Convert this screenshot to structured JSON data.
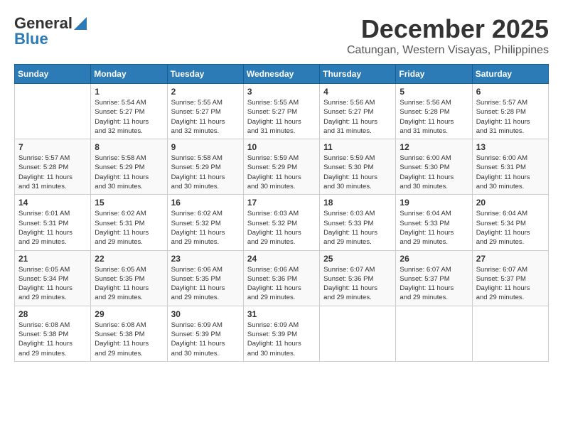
{
  "header": {
    "logo_line1": "General",
    "logo_line2": "Blue",
    "month": "December 2025",
    "location": "Catungan, Western Visayas, Philippines"
  },
  "days_of_week": [
    "Sunday",
    "Monday",
    "Tuesday",
    "Wednesday",
    "Thursday",
    "Friday",
    "Saturday"
  ],
  "weeks": [
    [
      {
        "day": "",
        "info": ""
      },
      {
        "day": "1",
        "info": "Sunrise: 5:54 AM\nSunset: 5:27 PM\nDaylight: 11 hours\nand 32 minutes."
      },
      {
        "day": "2",
        "info": "Sunrise: 5:55 AM\nSunset: 5:27 PM\nDaylight: 11 hours\nand 32 minutes."
      },
      {
        "day": "3",
        "info": "Sunrise: 5:55 AM\nSunset: 5:27 PM\nDaylight: 11 hours\nand 31 minutes."
      },
      {
        "day": "4",
        "info": "Sunrise: 5:56 AM\nSunset: 5:27 PM\nDaylight: 11 hours\nand 31 minutes."
      },
      {
        "day": "5",
        "info": "Sunrise: 5:56 AM\nSunset: 5:28 PM\nDaylight: 11 hours\nand 31 minutes."
      },
      {
        "day": "6",
        "info": "Sunrise: 5:57 AM\nSunset: 5:28 PM\nDaylight: 11 hours\nand 31 minutes."
      }
    ],
    [
      {
        "day": "7",
        "info": "Sunrise: 5:57 AM\nSunset: 5:28 PM\nDaylight: 11 hours\nand 31 minutes."
      },
      {
        "day": "8",
        "info": "Sunrise: 5:58 AM\nSunset: 5:29 PM\nDaylight: 11 hours\nand 30 minutes."
      },
      {
        "day": "9",
        "info": "Sunrise: 5:58 AM\nSunset: 5:29 PM\nDaylight: 11 hours\nand 30 minutes."
      },
      {
        "day": "10",
        "info": "Sunrise: 5:59 AM\nSunset: 5:29 PM\nDaylight: 11 hours\nand 30 minutes."
      },
      {
        "day": "11",
        "info": "Sunrise: 5:59 AM\nSunset: 5:30 PM\nDaylight: 11 hours\nand 30 minutes."
      },
      {
        "day": "12",
        "info": "Sunrise: 6:00 AM\nSunset: 5:30 PM\nDaylight: 11 hours\nand 30 minutes."
      },
      {
        "day": "13",
        "info": "Sunrise: 6:00 AM\nSunset: 5:31 PM\nDaylight: 11 hours\nand 30 minutes."
      }
    ],
    [
      {
        "day": "14",
        "info": "Sunrise: 6:01 AM\nSunset: 5:31 PM\nDaylight: 11 hours\nand 29 minutes."
      },
      {
        "day": "15",
        "info": "Sunrise: 6:02 AM\nSunset: 5:31 PM\nDaylight: 11 hours\nand 29 minutes."
      },
      {
        "day": "16",
        "info": "Sunrise: 6:02 AM\nSunset: 5:32 PM\nDaylight: 11 hours\nand 29 minutes."
      },
      {
        "day": "17",
        "info": "Sunrise: 6:03 AM\nSunset: 5:32 PM\nDaylight: 11 hours\nand 29 minutes."
      },
      {
        "day": "18",
        "info": "Sunrise: 6:03 AM\nSunset: 5:33 PM\nDaylight: 11 hours\nand 29 minutes."
      },
      {
        "day": "19",
        "info": "Sunrise: 6:04 AM\nSunset: 5:33 PM\nDaylight: 11 hours\nand 29 minutes."
      },
      {
        "day": "20",
        "info": "Sunrise: 6:04 AM\nSunset: 5:34 PM\nDaylight: 11 hours\nand 29 minutes."
      }
    ],
    [
      {
        "day": "21",
        "info": "Sunrise: 6:05 AM\nSunset: 5:34 PM\nDaylight: 11 hours\nand 29 minutes."
      },
      {
        "day": "22",
        "info": "Sunrise: 6:05 AM\nSunset: 5:35 PM\nDaylight: 11 hours\nand 29 minutes."
      },
      {
        "day": "23",
        "info": "Sunrise: 6:06 AM\nSunset: 5:35 PM\nDaylight: 11 hours\nand 29 minutes."
      },
      {
        "day": "24",
        "info": "Sunrise: 6:06 AM\nSunset: 5:36 PM\nDaylight: 11 hours\nand 29 minutes."
      },
      {
        "day": "25",
        "info": "Sunrise: 6:07 AM\nSunset: 5:36 PM\nDaylight: 11 hours\nand 29 minutes."
      },
      {
        "day": "26",
        "info": "Sunrise: 6:07 AM\nSunset: 5:37 PM\nDaylight: 11 hours\nand 29 minutes."
      },
      {
        "day": "27",
        "info": "Sunrise: 6:07 AM\nSunset: 5:37 PM\nDaylight: 11 hours\nand 29 minutes."
      }
    ],
    [
      {
        "day": "28",
        "info": "Sunrise: 6:08 AM\nSunset: 5:38 PM\nDaylight: 11 hours\nand 29 minutes."
      },
      {
        "day": "29",
        "info": "Sunrise: 6:08 AM\nSunset: 5:38 PM\nDaylight: 11 hours\nand 29 minutes."
      },
      {
        "day": "30",
        "info": "Sunrise: 6:09 AM\nSunset: 5:39 PM\nDaylight: 11 hours\nand 30 minutes."
      },
      {
        "day": "31",
        "info": "Sunrise: 6:09 AM\nSunset: 5:39 PM\nDaylight: 11 hours\nand 30 minutes."
      },
      {
        "day": "",
        "info": ""
      },
      {
        "day": "",
        "info": ""
      },
      {
        "day": "",
        "info": ""
      }
    ]
  ]
}
